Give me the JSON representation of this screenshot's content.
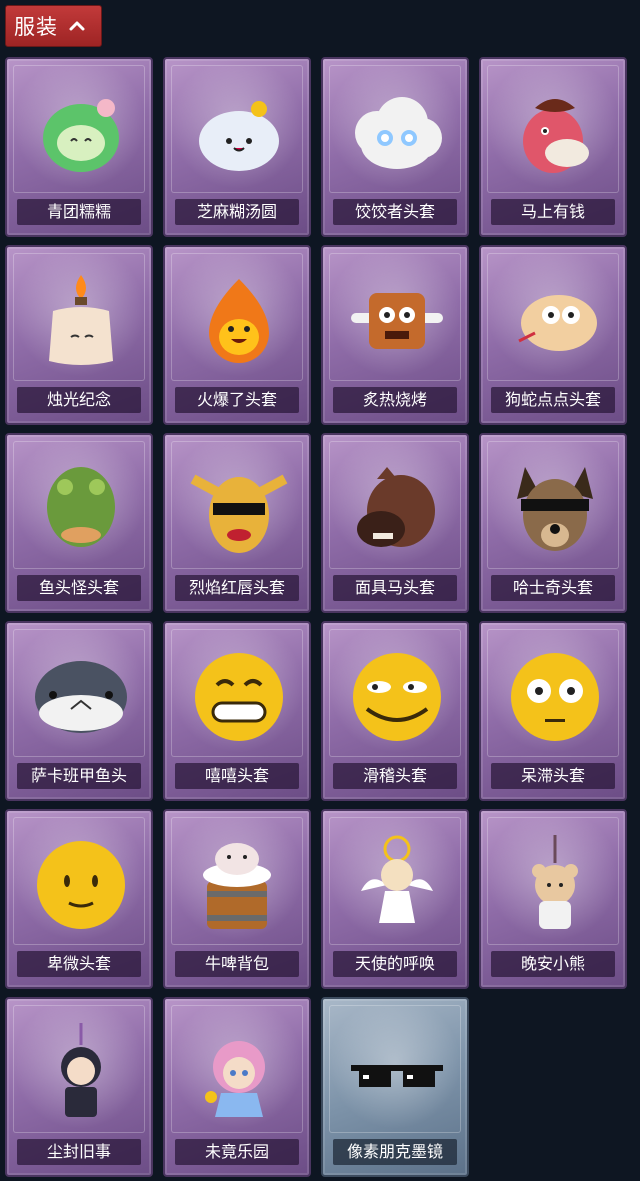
{
  "header": {
    "label": "服装"
  },
  "items": [
    {
      "name": "青团糯糯",
      "icon": "green-rice-ball-icon",
      "color": "#5cc46a"
    },
    {
      "name": "芝麻糊汤圆",
      "icon": "white-dumpling-icon",
      "color": "#e8eef8"
    },
    {
      "name": "饺饺者头套",
      "icon": "cloud-dumpling-icon",
      "color": "#f2f2f2"
    },
    {
      "name": "马上有钱",
      "icon": "pink-horse-icon",
      "color": "#e0566a"
    },
    {
      "name": "烛光纪念",
      "icon": "candle-icon",
      "color": "#f4e2cf"
    },
    {
      "name": "火爆了头套",
      "icon": "fire-spirit-icon",
      "color": "#f07818"
    },
    {
      "name": "炙热烧烤",
      "icon": "barbecue-meat-icon",
      "color": "#c46a2c"
    },
    {
      "name": "狗蛇点点头套",
      "icon": "snake-head-icon",
      "color": "#f2cfa0"
    },
    {
      "name": "鱼头怪头套",
      "icon": "fish-mask-icon",
      "color": "#6a9a3c"
    },
    {
      "name": "烈焰红唇头套",
      "icon": "yellow-mask-icon",
      "color": "#e8b23a"
    },
    {
      "name": "面具马头套",
      "icon": "horse-mask-icon",
      "color": "#6a3a2a"
    },
    {
      "name": "哈士奇头套",
      "icon": "husky-mask-icon",
      "color": "#8a6a4a"
    },
    {
      "name": "萨卡班甲鱼头",
      "icon": "fish-head-icon",
      "color": "#4a5262"
    },
    {
      "name": "嘻嘻头套",
      "icon": "grin-emoji-icon",
      "color": "#f4c21a"
    },
    {
      "name": "滑稽头套",
      "icon": "funny-emoji-icon",
      "color": "#f4c21a"
    },
    {
      "name": "呆滞头套",
      "icon": "stare-emoji-icon",
      "color": "#f4c21a"
    },
    {
      "name": "卑微头套",
      "icon": "humble-emoji-icon",
      "color": "#f4c21a"
    },
    {
      "name": "牛啤背包",
      "icon": "cow-beer-backpack-icon",
      "color": "#b06a2a"
    },
    {
      "name": "天使的呼唤",
      "icon": "angel-charm-icon",
      "color": "#f4e0c0"
    },
    {
      "name": "晚安小熊",
      "icon": "bear-charm-icon",
      "color": "#e8c8a0"
    },
    {
      "name": "尘封旧事",
      "icon": "boy-charm-icon",
      "color": "#2a2a3a"
    },
    {
      "name": "未竟乐园",
      "icon": "girl-charm-icon",
      "color": "#e89ac8"
    },
    {
      "name": "像素朋克墨镜",
      "icon": "pixel-sunglasses-icon",
      "color": "#111111"
    }
  ]
}
